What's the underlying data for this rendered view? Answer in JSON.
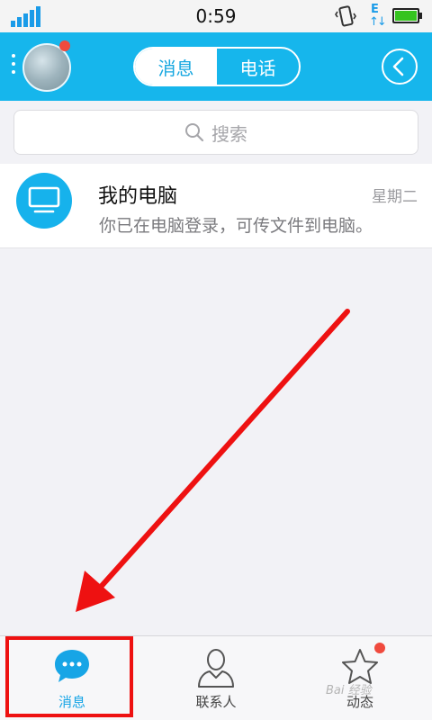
{
  "status_bar": {
    "time": "0:59",
    "network_letter": "E",
    "network_arrows": "↑↓"
  },
  "header": {
    "tabs": [
      {
        "label": "消息",
        "active": true
      },
      {
        "label": "电话",
        "active": false
      }
    ]
  },
  "search": {
    "placeholder": "搜索"
  },
  "conversations": [
    {
      "title": "我的电脑",
      "time": "星期二",
      "preview": "你已在电脑登录，可传文件到电脑。",
      "icon": "monitor-icon"
    }
  ],
  "tabbar": {
    "items": [
      {
        "label": "消息",
        "icon": "chat-bubble-icon",
        "active": true
      },
      {
        "label": "联系人",
        "icon": "contact-person-icon",
        "active": false
      },
      {
        "label": "动态",
        "icon": "star-icon",
        "active": false,
        "badge": true
      }
    ]
  },
  "watermark": "Bai 经验",
  "colors": {
    "accent": "#16b6ec",
    "badge": "#f04a3e",
    "annotation": "#ee1111"
  }
}
